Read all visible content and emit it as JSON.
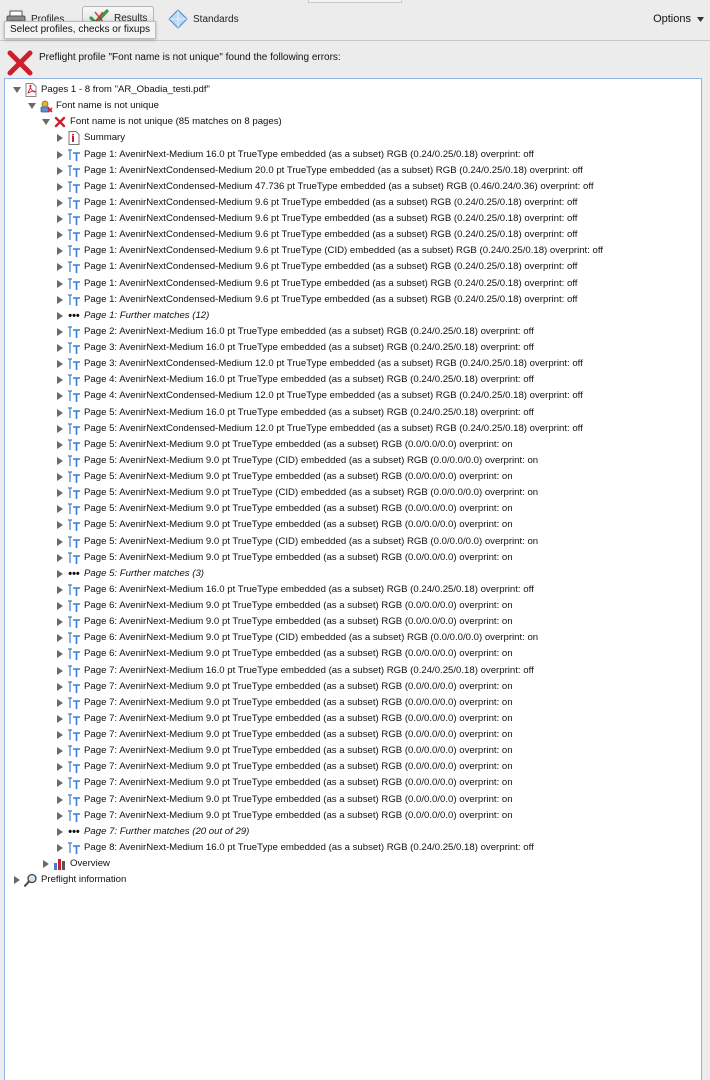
{
  "toolbar": {
    "tabs": [
      {
        "label": "Profiles",
        "icon": "printer-icon"
      },
      {
        "label": "Results",
        "icon": "checkmark-icon"
      },
      {
        "label": "Standards",
        "icon": "diamond-icon"
      }
    ],
    "options_label": "Options",
    "tooltip": "Select profiles, checks or fixups"
  },
  "banner": {
    "message": "Preflight profile \"Font name is not unique\" found the following errors:",
    "icon": "error-x-icon",
    "error_color": "#cc1f2d"
  },
  "colors": {
    "error": "#cc1f2d",
    "font_icon": "#3a7fd0",
    "selection_border": "#8fb6e6"
  },
  "tree": [
    {
      "level": 0,
      "toggle": "open",
      "icon": "pdf-icon",
      "label": "Pages 1 - 8 from \"AR_Obadia_testi.pdf\""
    },
    {
      "level": 1,
      "toggle": "open",
      "icon": "profile-icon",
      "label": "Font name is not unique"
    },
    {
      "level": 2,
      "toggle": "open",
      "icon": "error-icon",
      "label": "Font name is not unique (85 matches on 8 pages)"
    },
    {
      "level": 3,
      "toggle": "closed",
      "icon": "summary-icon",
      "label": "Summary"
    },
    {
      "level": 3,
      "toggle": "closed",
      "icon": "font-icon",
      "label": "Page 1: AvenirNext-Medium 16.0 pt TrueType  embedded (as a subset) RGB (0.24/0.25/0.18)  overprint: off"
    },
    {
      "level": 3,
      "toggle": "closed",
      "icon": "font-icon",
      "label": "Page 1: AvenirNextCondensed-Medium 20.0 pt TrueType  embedded (as a subset) RGB (0.24/0.25/0.18)  overprint: off"
    },
    {
      "level": 3,
      "toggle": "closed",
      "icon": "font-icon",
      "label": "Page 1: AvenirNextCondensed-Medium 47.736 pt TrueType  embedded (as a subset) RGB (0.46/0.24/0.36)  overprint: off"
    },
    {
      "level": 3,
      "toggle": "closed",
      "icon": "font-icon",
      "label": "Page 1: AvenirNextCondensed-Medium 9.6 pt TrueType  embedded (as a subset) RGB (0.24/0.25/0.18)  overprint: off"
    },
    {
      "level": 3,
      "toggle": "closed",
      "icon": "font-icon",
      "label": "Page 1: AvenirNextCondensed-Medium 9.6 pt TrueType  embedded (as a subset) RGB (0.24/0.25/0.18)  overprint: off"
    },
    {
      "level": 3,
      "toggle": "closed",
      "icon": "font-icon",
      "label": "Page 1: AvenirNextCondensed-Medium 9.6 pt TrueType  embedded (as a subset) RGB (0.24/0.25/0.18)  overprint: off"
    },
    {
      "level": 3,
      "toggle": "closed",
      "icon": "font-icon",
      "label": "Page 1: AvenirNextCondensed-Medium 9.6 pt TrueType (CID)  embedded (as a subset) RGB (0.24/0.25/0.18)  overprint: off"
    },
    {
      "level": 3,
      "toggle": "closed",
      "icon": "font-icon",
      "label": "Page 1: AvenirNextCondensed-Medium 9.6 pt TrueType  embedded (as a subset) RGB (0.24/0.25/0.18)  overprint: off"
    },
    {
      "level": 3,
      "toggle": "closed",
      "icon": "font-icon",
      "label": "Page 1: AvenirNextCondensed-Medium 9.6 pt TrueType  embedded (as a subset) RGB (0.24/0.25/0.18)  overprint: off"
    },
    {
      "level": 3,
      "toggle": "closed",
      "icon": "font-icon",
      "label": "Page 1: AvenirNextCondensed-Medium 9.6 pt TrueType  embedded (as a subset) RGB (0.24/0.25/0.18)  overprint: off"
    },
    {
      "level": 3,
      "toggle": "closed",
      "icon": "more-icon",
      "label": "Page 1: Further matches (12)",
      "italic": true
    },
    {
      "level": 3,
      "toggle": "closed",
      "icon": "font-icon",
      "label": "Page 2: AvenirNext-Medium 16.0 pt TrueType  embedded (as a subset) RGB (0.24/0.25/0.18)  overprint: off"
    },
    {
      "level": 3,
      "toggle": "closed",
      "icon": "font-icon",
      "label": "Page 3: AvenirNext-Medium 16.0 pt TrueType  embedded (as a subset) RGB (0.24/0.25/0.18)  overprint: off"
    },
    {
      "level": 3,
      "toggle": "closed",
      "icon": "font-icon",
      "label": "Page 3: AvenirNextCondensed-Medium 12.0 pt TrueType  embedded (as a subset) RGB (0.24/0.25/0.18)  overprint: off"
    },
    {
      "level": 3,
      "toggle": "closed",
      "icon": "font-icon",
      "label": "Page 4: AvenirNext-Medium 16.0 pt TrueType  embedded (as a subset) RGB (0.24/0.25/0.18)  overprint: off"
    },
    {
      "level": 3,
      "toggle": "closed",
      "icon": "font-icon",
      "label": "Page 4: AvenirNextCondensed-Medium 12.0 pt TrueType  embedded (as a subset) RGB (0.24/0.25/0.18)  overprint: off"
    },
    {
      "level": 3,
      "toggle": "closed",
      "icon": "font-icon",
      "label": "Page 5: AvenirNext-Medium 16.0 pt TrueType  embedded (as a subset) RGB (0.24/0.25/0.18)  overprint: off"
    },
    {
      "level": 3,
      "toggle": "closed",
      "icon": "font-icon",
      "label": "Page 5: AvenirNextCondensed-Medium 12.0 pt TrueType  embedded (as a subset) RGB (0.24/0.25/0.18)  overprint: off"
    },
    {
      "level": 3,
      "toggle": "closed",
      "icon": "font-icon",
      "label": "Page 5: AvenirNext-Medium 9.0 pt TrueType  embedded (as a subset) RGB (0.0/0.0/0.0)  overprint: on"
    },
    {
      "level": 3,
      "toggle": "closed",
      "icon": "font-icon",
      "label": "Page 5: AvenirNext-Medium 9.0 pt TrueType (CID)  embedded (as a subset) RGB (0.0/0.0/0.0)  overprint: on"
    },
    {
      "level": 3,
      "toggle": "closed",
      "icon": "font-icon",
      "label": "Page 5: AvenirNext-Medium 9.0 pt TrueType  embedded (as a subset) RGB (0.0/0.0/0.0)  overprint: on"
    },
    {
      "level": 3,
      "toggle": "closed",
      "icon": "font-icon",
      "label": "Page 5: AvenirNext-Medium 9.0 pt TrueType (CID)  embedded (as a subset) RGB (0.0/0.0/0.0)  overprint: on"
    },
    {
      "level": 3,
      "toggle": "closed",
      "icon": "font-icon",
      "label": "Page 5: AvenirNext-Medium 9.0 pt TrueType  embedded (as a subset) RGB (0.0/0.0/0.0)  overprint: on"
    },
    {
      "level": 3,
      "toggle": "closed",
      "icon": "font-icon",
      "label": "Page 5: AvenirNext-Medium 9.0 pt TrueType  embedded (as a subset) RGB (0.0/0.0/0.0)  overprint: on"
    },
    {
      "level": 3,
      "toggle": "closed",
      "icon": "font-icon",
      "label": "Page 5: AvenirNext-Medium 9.0 pt TrueType (CID)  embedded (as a subset) RGB (0.0/0.0/0.0)  overprint: on"
    },
    {
      "level": 3,
      "toggle": "closed",
      "icon": "font-icon",
      "label": "Page 5: AvenirNext-Medium 9.0 pt TrueType  embedded (as a subset) RGB (0.0/0.0/0.0)  overprint: on"
    },
    {
      "level": 3,
      "toggle": "closed",
      "icon": "more-icon",
      "label": "Page 5: Further matches (3)",
      "italic": true
    },
    {
      "level": 3,
      "toggle": "closed",
      "icon": "font-icon",
      "label": "Page 6: AvenirNext-Medium 16.0 pt TrueType  embedded (as a subset) RGB (0.24/0.25/0.18)  overprint: off"
    },
    {
      "level": 3,
      "toggle": "closed",
      "icon": "font-icon",
      "label": "Page 6: AvenirNext-Medium 9.0 pt TrueType  embedded (as a subset) RGB (0.0/0.0/0.0)  overprint: on"
    },
    {
      "level": 3,
      "toggle": "closed",
      "icon": "font-icon",
      "label": "Page 6: AvenirNext-Medium 9.0 pt TrueType  embedded (as a subset) RGB (0.0/0.0/0.0)  overprint: on"
    },
    {
      "level": 3,
      "toggle": "closed",
      "icon": "font-icon",
      "label": "Page 6: AvenirNext-Medium 9.0 pt TrueType (CID)  embedded (as a subset) RGB (0.0/0.0/0.0)  overprint: on"
    },
    {
      "level": 3,
      "toggle": "closed",
      "icon": "font-icon",
      "label": "Page 6: AvenirNext-Medium 9.0 pt TrueType  embedded (as a subset) RGB (0.0/0.0/0.0)  overprint: on"
    },
    {
      "level": 3,
      "toggle": "closed",
      "icon": "font-icon",
      "label": "Page 7: AvenirNext-Medium 16.0 pt TrueType  embedded (as a subset) RGB (0.24/0.25/0.18)  overprint: off"
    },
    {
      "level": 3,
      "toggle": "closed",
      "icon": "font-icon",
      "label": "Page 7: AvenirNext-Medium 9.0 pt TrueType  embedded (as a subset) RGB (0.0/0.0/0.0)  overprint: on"
    },
    {
      "level": 3,
      "toggle": "closed",
      "icon": "font-icon",
      "label": "Page 7: AvenirNext-Medium 9.0 pt TrueType  embedded (as a subset) RGB (0.0/0.0/0.0)  overprint: on"
    },
    {
      "level": 3,
      "toggle": "closed",
      "icon": "font-icon",
      "label": "Page 7: AvenirNext-Medium 9.0 pt TrueType  embedded (as a subset) RGB (0.0/0.0/0.0)  overprint: on"
    },
    {
      "level": 3,
      "toggle": "closed",
      "icon": "font-icon",
      "label": "Page 7: AvenirNext-Medium 9.0 pt TrueType  embedded (as a subset) RGB (0.0/0.0/0.0)  overprint: on"
    },
    {
      "level": 3,
      "toggle": "closed",
      "icon": "font-icon",
      "label": "Page 7: AvenirNext-Medium 9.0 pt TrueType  embedded (as a subset) RGB (0.0/0.0/0.0)  overprint: on"
    },
    {
      "level": 3,
      "toggle": "closed",
      "icon": "font-icon",
      "label": "Page 7: AvenirNext-Medium 9.0 pt TrueType  embedded (as a subset) RGB (0.0/0.0/0.0)  overprint: on"
    },
    {
      "level": 3,
      "toggle": "closed",
      "icon": "font-icon",
      "label": "Page 7: AvenirNext-Medium 9.0 pt TrueType  embedded (as a subset) RGB (0.0/0.0/0.0)  overprint: on"
    },
    {
      "level": 3,
      "toggle": "closed",
      "icon": "font-icon",
      "label": "Page 7: AvenirNext-Medium 9.0 pt TrueType  embedded (as a subset) RGB (0.0/0.0/0.0)  overprint: on"
    },
    {
      "level": 3,
      "toggle": "closed",
      "icon": "font-icon",
      "label": "Page 7: AvenirNext-Medium 9.0 pt TrueType  embedded (as a subset) RGB (0.0/0.0/0.0)  overprint: on"
    },
    {
      "level": 3,
      "toggle": "closed",
      "icon": "more-icon",
      "label": "Page 7: Further matches (20 out of 29)",
      "italic": true
    },
    {
      "level": 3,
      "toggle": "closed",
      "icon": "font-icon",
      "label": "Page 8: AvenirNext-Medium 16.0 pt TrueType  embedded (as a subset) RGB (0.24/0.25/0.18)  overprint: off"
    },
    {
      "level": 2,
      "toggle": "closed",
      "icon": "overview-icon",
      "label": "Overview"
    },
    {
      "level": 0,
      "toggle": "closed",
      "icon": "magnifier-icon",
      "label": "Preflight information"
    }
  ]
}
